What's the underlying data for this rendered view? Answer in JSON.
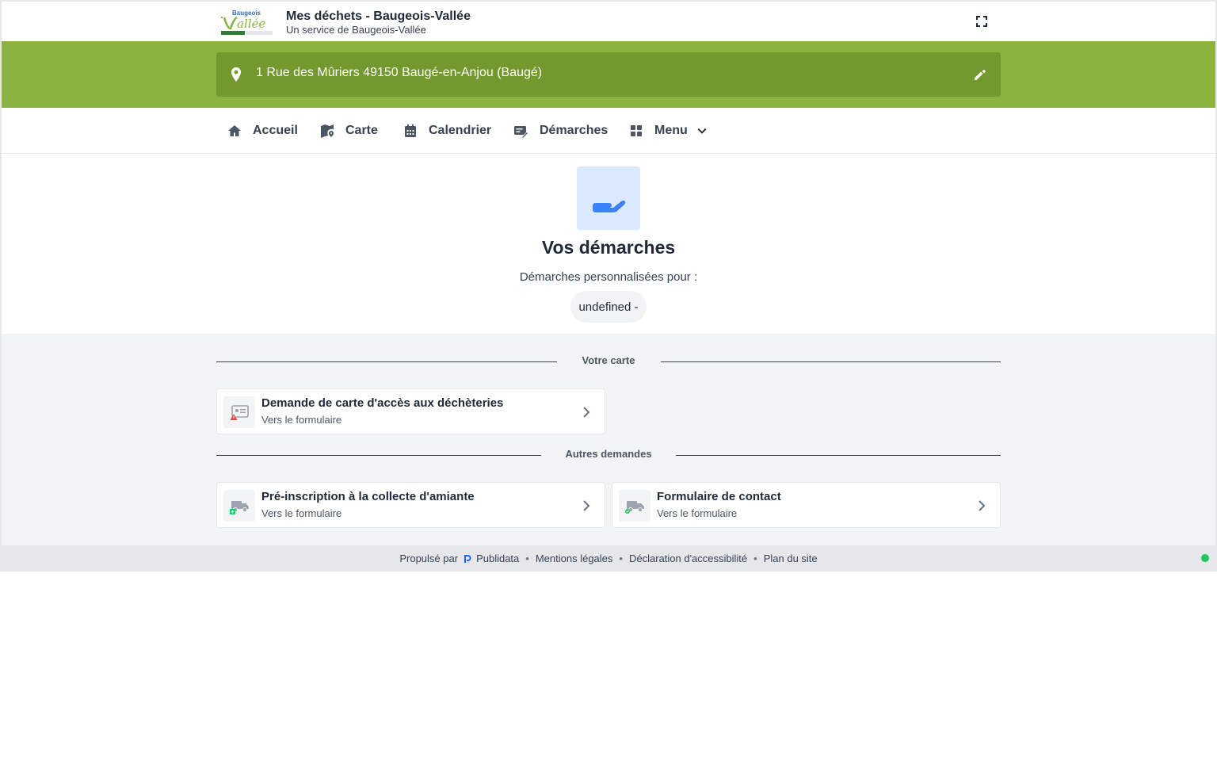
{
  "header": {
    "title": "Mes déchets - Baugeois-Vallée",
    "subtitle": "Un service de Baugeois-Vallée",
    "logo_text": "Baugeois Vallée",
    "fullscreen_icon": "fullscreen-icon"
  },
  "address": {
    "text": "1 Rue des Mûriers 49150 Baugé-en-Anjou (Baugé)",
    "pin_icon": "location-pin-icon",
    "edit_icon": "pencil-icon"
  },
  "nav": {
    "items": [
      {
        "label": "Accueil",
        "icon": "home-icon"
      },
      {
        "label": "Carte",
        "icon": "map-icon"
      },
      {
        "label": "Calendrier",
        "icon": "calendar-icon"
      },
      {
        "label": "Démarches",
        "icon": "form-edit-icon"
      },
      {
        "label": "Menu",
        "icon": "grid-icon"
      }
    ]
  },
  "hero": {
    "icon": "hand-icon",
    "title": "Vos démarches",
    "subtitle": "Démarches personnalisées pour :",
    "pill": "undefined -"
  },
  "sections": [
    {
      "label": "Votre carte",
      "cards": [
        {
          "title": "Demande de carte d'accès aux déchèteries",
          "subtitle": "Vers le formulaire",
          "icon": "id-card-warning-icon"
        }
      ]
    },
    {
      "label": "Autres demandes",
      "cards": [
        {
          "title": "Pré-inscription à la collecte d'amiante",
          "subtitle": "Vers le formulaire",
          "icon": "truck-plus-icon"
        },
        {
          "title": "Formulaire de contact",
          "subtitle": "Vers le formulaire",
          "icon": "truck-check-icon"
        }
      ]
    }
  ],
  "footer": {
    "powered_by": "Propulsé par",
    "brand": "Publidata",
    "links": [
      "Mentions légales",
      "Déclaration d'accessibilité",
      "Plan du site"
    ]
  },
  "colors": {
    "brand_green": "#8bb23e",
    "address_green": "#73992e",
    "hero_icon_bg": "#dbeafe",
    "hero_icon": "#3b82f6",
    "status_dot": "#22c55e"
  }
}
